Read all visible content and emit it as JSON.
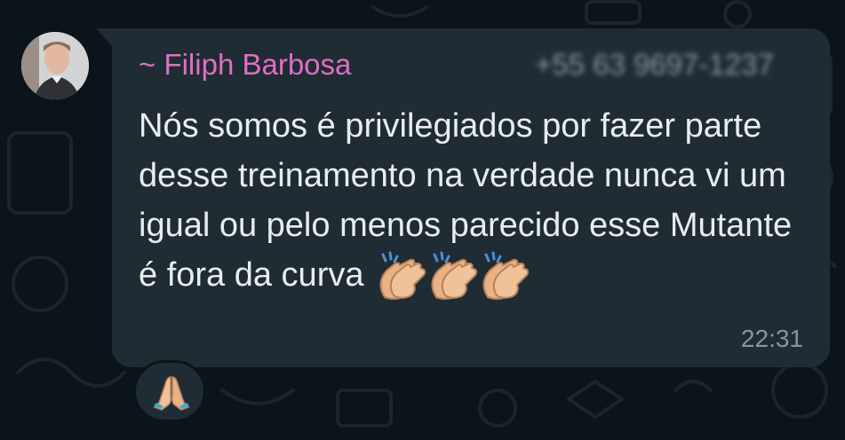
{
  "message": {
    "sender_name": "~ Filiph Barbosa",
    "sender_phone": "+55 63 9697-1237",
    "text": "Nós somos é privilegiados por fazer parte desse treinamento na verdade nunca vi um igual ou pelo menos parecido esse Mutante é fora da curva",
    "emoji": [
      "clapping-hands",
      "clapping-hands",
      "clapping-hands"
    ],
    "timestamp": "22:31"
  },
  "reaction": {
    "emoji": "folded-hands"
  },
  "colors": {
    "background": "#0b141a",
    "bubble": "#1f2c34",
    "sender_name": "#e06ec4",
    "text": "#e9edef",
    "meta": "#8696a0"
  }
}
